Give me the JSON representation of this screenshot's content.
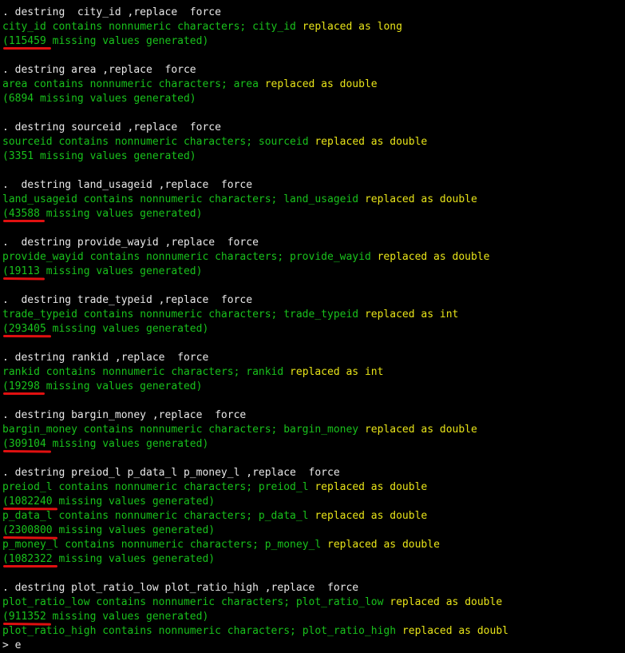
{
  "blocks": [
    {
      "command": ". destring  city_id ,replace  force",
      "results": [
        {
          "var": "city_id",
          "contains": " contains nonnumeric characters; ",
          "var2": "city_id",
          "replaced": " replaced as ",
          "type": "long",
          "missing": "(115459 missing values generated)"
        }
      ]
    },
    {
      "command": ". destring area ,replace  force",
      "results": [
        {
          "var": "area",
          "contains": " contains nonnumeric characters; ",
          "var2": "area",
          "replaced": " replaced as ",
          "type": "double",
          "missing": "(6894 missing values generated)"
        }
      ]
    },
    {
      "command": ". destring sourceid ,replace  force",
      "results": [
        {
          "var": "sourceid",
          "contains": " contains nonnumeric characters; ",
          "var2": "sourceid",
          "replaced": " replaced as ",
          "type": "double",
          "missing": "(3351 missing values generated)"
        }
      ]
    },
    {
      "command": ".  destring land_usageid ,replace  force",
      "results": [
        {
          "var": "land_usageid",
          "contains": " contains nonnumeric characters; ",
          "var2": "land_usageid",
          "replaced": " replaced as ",
          "type": "double",
          "missing": "(43588 missing values generated)"
        }
      ]
    },
    {
      "command": ".  destring provide_wayid ,replace  force",
      "results": [
        {
          "var": "provide_wayid",
          "contains": " contains nonnumeric characters; ",
          "var2": "provide_wayid",
          "replaced": " replaced as ",
          "type": "double",
          "missing": "(19113 missing values generated)"
        }
      ]
    },
    {
      "command": ".  destring trade_typeid ,replace  force",
      "results": [
        {
          "var": "trade_typeid",
          "contains": " contains nonnumeric characters; ",
          "var2": "trade_typeid",
          "replaced": " replaced as ",
          "type": "int",
          "missing": "(293405 missing values generated)"
        }
      ]
    },
    {
      "command": ". destring rankid ,replace  force",
      "results": [
        {
          "var": "rankid",
          "contains": " contains nonnumeric characters; ",
          "var2": "rankid",
          "replaced": " replaced as ",
          "type": "int",
          "missing": "(19298 missing values generated)"
        }
      ]
    },
    {
      "command": ". destring bargin_money ,replace  force",
      "results": [
        {
          "var": "bargin_money",
          "contains": " contains nonnumeric characters; ",
          "var2": "bargin_money",
          "replaced": " replaced as ",
          "type": "double",
          "missing": "(309104 missing values generated)"
        }
      ]
    },
    {
      "command": ". destring preiod_l p_data_l p_money_l ,replace  force",
      "results": [
        {
          "var": "preiod_l",
          "contains": " contains nonnumeric characters; ",
          "var2": "preiod_l",
          "replaced": " replaced as ",
          "type": "double",
          "missing": "(1082240 missing values generated)"
        },
        {
          "var": "p_data_l",
          "contains": " contains nonnumeric characters; ",
          "var2": "p_data_l",
          "replaced": " replaced as ",
          "type": "double",
          "missing": "(2300800 missing values generated)"
        },
        {
          "var": "p_money_l",
          "contains": " contains nonnumeric characters; ",
          "var2": "p_money_l",
          "replaced": " replaced as ",
          "type": "double",
          "missing": "(1082322 missing values generated)"
        }
      ]
    },
    {
      "command": ". destring plot_ratio_low plot_ratio_high ,replace  force",
      "results": [
        {
          "var": "plot_ratio_low",
          "contains": " contains nonnumeric characters; ",
          "var2": "plot_ratio_low",
          "replaced": " replaced as ",
          "type": "double",
          "missing": "(911352 missing values generated)"
        },
        {
          "var": "plot_ratio_high",
          "contains": " contains nonnumeric characters; ",
          "var2": "plot_ratio_high",
          "replaced": " replaced as ",
          "type": "doubl",
          "missing": null
        }
      ]
    }
  ],
  "prompt": "> e",
  "colors": {
    "background": "#000000",
    "command_text": "#e8e8e8",
    "output_green": "#19c21c",
    "output_yellow": "#e8e419",
    "annotation_red": "#e01010"
  }
}
